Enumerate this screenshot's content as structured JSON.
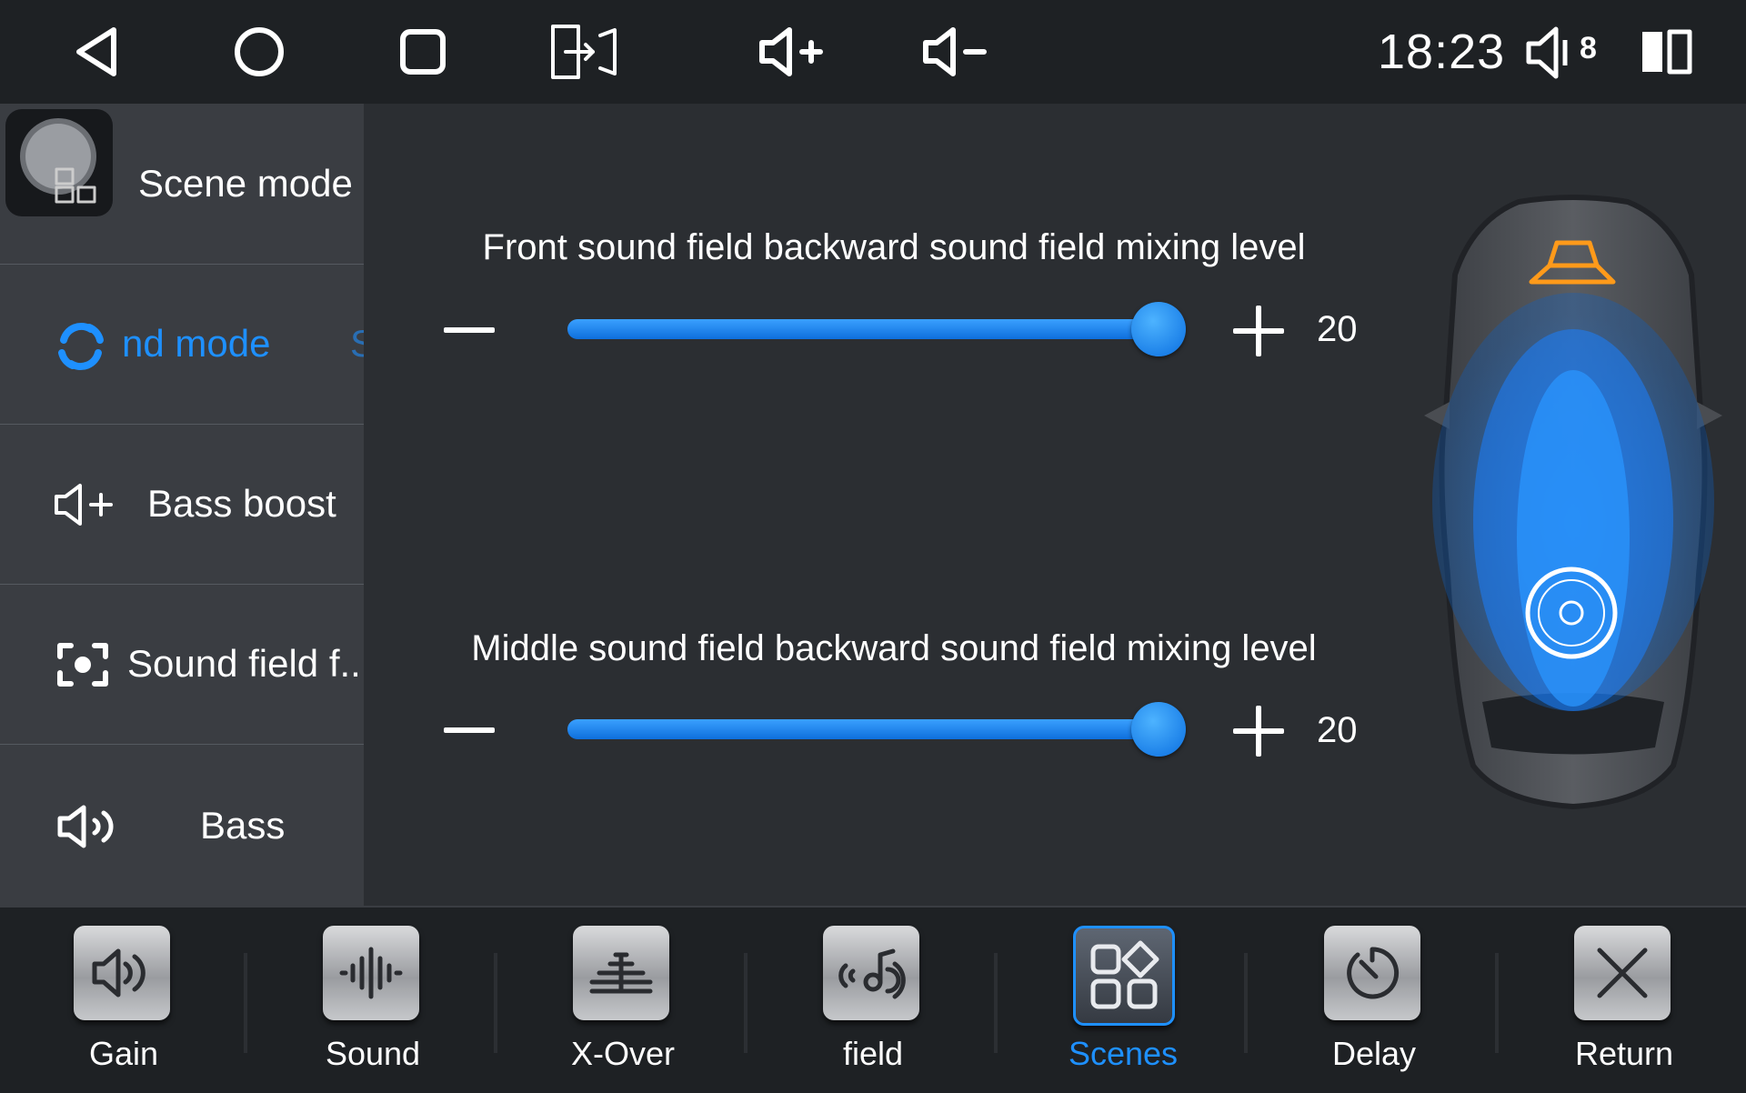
{
  "status_bar": {
    "clock": "18:23",
    "volume_level": "8"
  },
  "sidebar": {
    "items": [
      {
        "label": "Scene mode",
        "icon": "scene-app-icon"
      },
      {
        "label": "nd mode",
        "icon": "sound-mode-icon",
        "active": true
      },
      {
        "label": "Bass boost",
        "icon": "volume-plus-icon"
      },
      {
        "label": "Sound field f..",
        "icon": "focus-icon"
      },
      {
        "label": "Bass",
        "icon": "speaker-icon"
      }
    ]
  },
  "sliders": [
    {
      "title": "Front sound field backward sound field mixing level",
      "value": "20",
      "fill_fraction": 1.0
    },
    {
      "title": "Middle sound field backward sound field mixing level",
      "value": "20",
      "fill_fraction": 1.0
    }
  ],
  "tabs": [
    {
      "label": "Gain",
      "icon": "speaker-gain-icon"
    },
    {
      "label": "Sound",
      "icon": "waveform-icon"
    },
    {
      "label": "X-Over",
      "icon": "crossover-icon"
    },
    {
      "label": "field",
      "icon": "sound-field-icon"
    },
    {
      "label": "Scenes",
      "icon": "scenes-icon",
      "active": true
    },
    {
      "label": "Delay",
      "icon": "delay-icon"
    },
    {
      "label": "Return",
      "icon": "return-icon"
    }
  ],
  "colors": {
    "accent": "#1e90ff",
    "background": "#2b2e32",
    "bar": "#1e2124",
    "sidebar": "#3a3d42"
  }
}
